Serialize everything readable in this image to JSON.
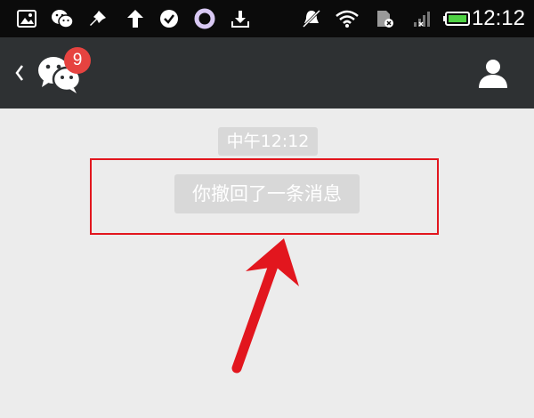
{
  "status_bar": {
    "time": "12:12",
    "icons": [
      "gallery-icon",
      "wechat-icon",
      "pin-icon",
      "upload-arrow-icon",
      "check-circle-icon",
      "ring-icon",
      "download-icon",
      "mute-icon",
      "wifi-icon",
      "sim-icon",
      "signal-icon",
      "battery-icon"
    ]
  },
  "title_bar": {
    "back_glyph": "‹",
    "unread_count": "9"
  },
  "chat": {
    "timestamp": "中午12:12",
    "recall_notice": "你撤回了一条消息"
  },
  "colors": {
    "status_bg": "#0b0b0b",
    "title_bg": "#2e3133",
    "chat_bg": "#ececec",
    "bubble_bg": "#d8d8d8",
    "badge": "#e64340",
    "highlight": "#e2161e"
  }
}
